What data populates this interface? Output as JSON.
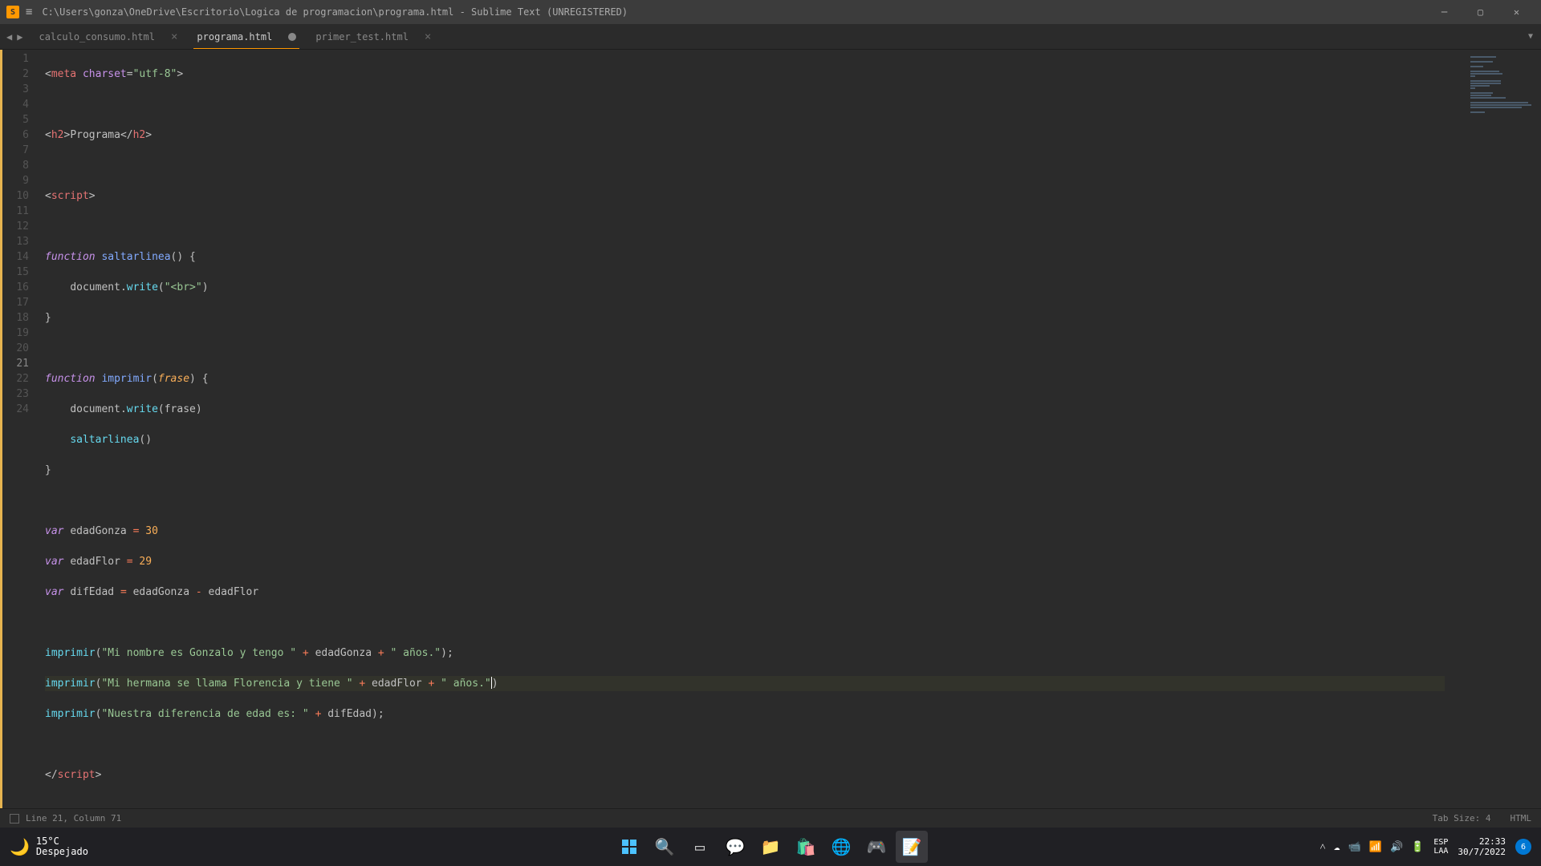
{
  "window": {
    "title": "C:\\Users\\gonza\\OneDrive\\Escritorio\\Logica de programacion\\programa.html - Sublime Text (UNREGISTERED)"
  },
  "tabs": [
    {
      "label": "calculo_consumo.html",
      "active": false,
      "dirty": false
    },
    {
      "label": "programa.html",
      "active": true,
      "dirty": true
    },
    {
      "label": "primer_test.html",
      "active": false,
      "dirty": false
    }
  ],
  "code": {
    "lines": 24,
    "active_line": 21,
    "l1": {
      "meta": "meta",
      "charset_attr": "charset",
      "charset_val": "\"utf-8\""
    },
    "l3": {
      "h2": "h2",
      "text": "Programa"
    },
    "l5": {
      "script": "script"
    },
    "l7": {
      "fn": "function",
      "name": "saltarlinea"
    },
    "l8": {
      "doc": "document",
      "write": "write",
      "arg": "\"<br>\""
    },
    "l10": {
      "fn": "function",
      "name": "imprimir",
      "param": "frase"
    },
    "l11": {
      "doc": "document",
      "write": "write",
      "arg": "frase"
    },
    "l12": {
      "call": "saltarlinea"
    },
    "l16": {
      "var": "var",
      "name": "edadGonza",
      "val": "30"
    },
    "l17": {
      "var": "var",
      "name": "edadFlor",
      "val": "29"
    },
    "l18": {
      "var": "var",
      "name": "difEdad",
      "a": "edadGonza",
      "b": "edadFlor"
    },
    "l20": {
      "call": "imprimir",
      "s1": "\"Mi nombre es Gonzalo y tengo \"",
      "v": "edadGonza",
      "s2": "\" años.\""
    },
    "l21": {
      "call": "imprimir",
      "s1": "\"Mi hermana se llama Florencia y tiene \"",
      "v": "edadFlor",
      "s2": "\" años.\""
    },
    "l22": {
      "call": "imprimir",
      "s1": "\"Nuestra diferencia de edad es: \"",
      "v": "difEdad"
    },
    "l24": {
      "script": "script"
    }
  },
  "statusbar": {
    "position": "Line 21, Column 71",
    "tabsize": "Tab Size: 4",
    "syntax": "HTML"
  },
  "taskbar": {
    "weather": {
      "temp": "15°C",
      "desc": "Despejado"
    },
    "lang": {
      "code": "ESP",
      "kb": "LAA"
    },
    "clock": {
      "time": "22:33",
      "date": "30/7/2022"
    },
    "notif_count": "6"
  }
}
